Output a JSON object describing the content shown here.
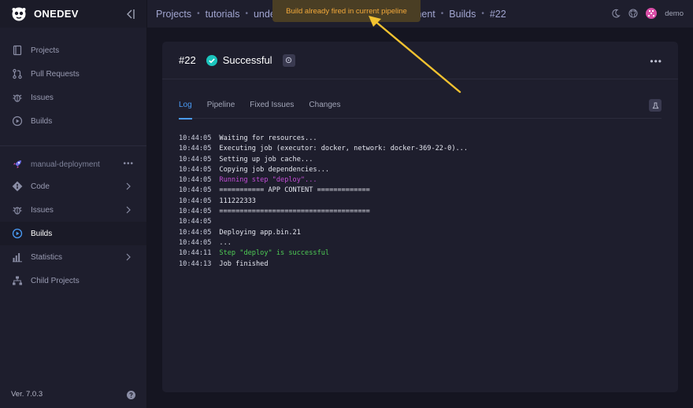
{
  "app": {
    "name": "ONEDEV",
    "version": "Ver. 7.0.3"
  },
  "sidebar": {
    "global_items": [
      {
        "label": "Projects",
        "icon": "projects-icon"
      },
      {
        "label": "Pull Requests",
        "icon": "pull-request-icon"
      },
      {
        "label": "Issues",
        "icon": "bug-icon"
      },
      {
        "label": "Builds",
        "icon": "play-circle-icon"
      }
    ],
    "project": {
      "name": "manual-deployment",
      "more": "•••"
    },
    "project_items": [
      {
        "label": "Code",
        "icon": "git-icon",
        "has_children": true
      },
      {
        "label": "Issues",
        "icon": "bug-icon",
        "has_children": true
      },
      {
        "label": "Builds",
        "icon": "play-circle-icon",
        "active": true
      },
      {
        "label": "Statistics",
        "icon": "bar-chart-icon",
        "has_children": true
      },
      {
        "label": "Child Projects",
        "icon": "tree-icon"
      }
    ]
  },
  "breadcrumb": {
    "items": [
      "Projects",
      "tutorials",
      "unde",
      "oyment",
      "Builds",
      "#22"
    ]
  },
  "toast": {
    "message": "Build already fired in current pipeline"
  },
  "user": {
    "name": "demo"
  },
  "build": {
    "number": "#22",
    "status": "Successful",
    "status_color": "#1bc5bd",
    "more": "•••"
  },
  "tabs": [
    {
      "label": "Log",
      "active": true
    },
    {
      "label": "Pipeline"
    },
    {
      "label": "Fixed Issues"
    },
    {
      "label": "Changes"
    }
  ],
  "log": [
    {
      "time": "10:44:05",
      "msg": "Waiting for resources...",
      "style": ""
    },
    {
      "time": "10:44:05",
      "msg": "Executing job (executor: docker, network: docker-369-22-0)...",
      "style": ""
    },
    {
      "time": "10:44:05",
      "msg": "Setting up job cache...",
      "style": ""
    },
    {
      "time": "10:44:05",
      "msg": "Copying job dependencies...",
      "style": ""
    },
    {
      "time": "10:44:05",
      "msg": "Running step \"deploy\"...",
      "style": "purple"
    },
    {
      "time": "10:44:05",
      "msg": "=========== APP CONTENT =============",
      "style": ""
    },
    {
      "time": "10:44:05",
      "msg": "111222333",
      "style": ""
    },
    {
      "time": "10:44:05",
      "msg": "=====================================",
      "style": ""
    },
    {
      "time": "10:44:05",
      "msg": "",
      "style": ""
    },
    {
      "time": "10:44:05",
      "msg": "Deploying app.bin.21",
      "style": ""
    },
    {
      "time": "10:44:05",
      "msg": "...",
      "style": ""
    },
    {
      "time": "10:44:11",
      "msg": "Step \"deploy\" is successful",
      "style": "green"
    },
    {
      "time": "10:44:13",
      "msg": "Job finished",
      "style": ""
    }
  ],
  "colors": {
    "accent": "#4a9bf5",
    "toast_text": "#f3a93a",
    "arrow": "#f2c230"
  }
}
